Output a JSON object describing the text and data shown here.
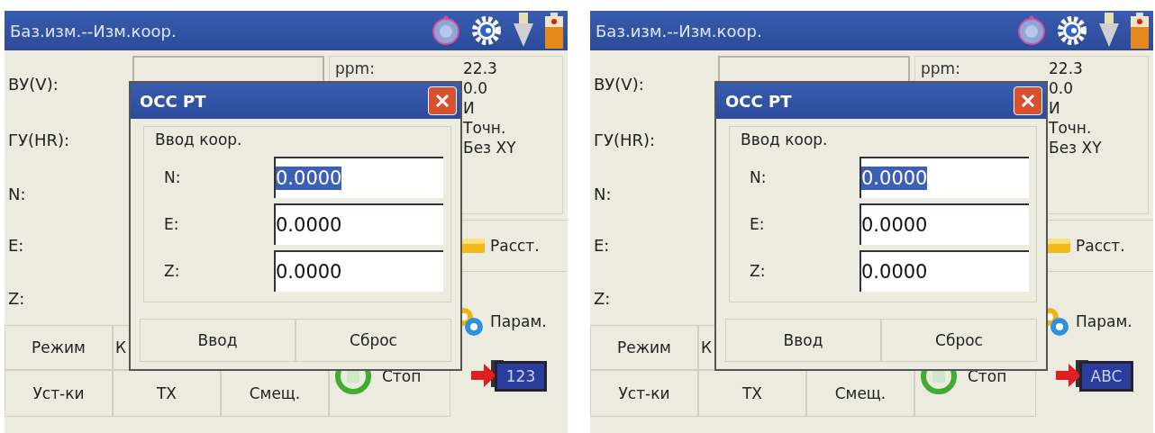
{
  "screens": [
    {
      "title": "Баз.изм.--Изм.коор.",
      "labels": [
        "ВУ(V):",
        "ГУ(HR):",
        "N:",
        "E:",
        "Z:"
      ],
      "info_label": "ppm:",
      "info_values": [
        "22.3",
        "0.0",
        "И",
        "Точн.",
        "Без XY"
      ],
      "side_buttons": [
        "Расст.",
        "Парам."
      ],
      "bottom_buttons": [
        [
          "Режим",
          "К"
        ],
        [
          "Уст-ки",
          "ТХ",
          "Смещ."
        ]
      ],
      "stop_button": "Стоп",
      "mode_key": "123",
      "dialog": {
        "title": "OCC PT",
        "group": "Ввод коор.",
        "fields": [
          {
            "label": "N:",
            "value": "0.0000",
            "selected": true
          },
          {
            "label": "E:",
            "value": "0.0000",
            "selected": false
          },
          {
            "label": "Z:",
            "value": "0.0000",
            "selected": false
          }
        ],
        "buttons": [
          "Ввод",
          "Сброс"
        ]
      }
    },
    {
      "title": "Баз.изм.--Изм.коор.",
      "labels": [
        "ВУ(V):",
        "ГУ(HR):",
        "N:",
        "E:",
        "Z:"
      ],
      "info_label": "ppm:",
      "info_values": [
        "22.3",
        "0.0",
        "И",
        "Точн.",
        "Без XY"
      ],
      "side_buttons": [
        "Расст.",
        "Парам."
      ],
      "bottom_buttons": [
        [
          "Режим",
          "К"
        ],
        [
          "Уст-ки",
          "ТХ",
          "Смещ."
        ]
      ],
      "stop_button": "Стоп",
      "mode_key": "ABC",
      "dialog": {
        "title": "OCC PT",
        "group": "Ввод коор.",
        "fields": [
          {
            "label": "N:",
            "value": "0.0000",
            "selected": true
          },
          {
            "label": "E:",
            "value": "0.0000",
            "selected": false
          },
          {
            "label": "Z:",
            "value": "0.0000",
            "selected": false
          }
        ],
        "buttons": [
          "Ввод",
          "Сброс"
        ]
      }
    }
  ]
}
